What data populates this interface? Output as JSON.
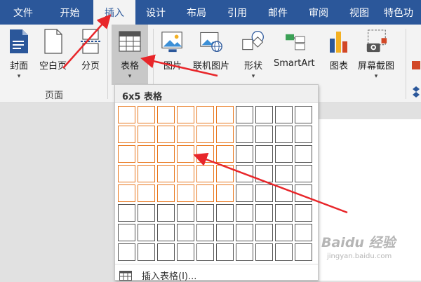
{
  "tabs": [
    {
      "label": "文件",
      "active": false
    },
    {
      "label": "开始",
      "active": false
    },
    {
      "label": "插入",
      "active": true
    },
    {
      "label": "设计",
      "active": false
    },
    {
      "label": "布局",
      "active": false
    },
    {
      "label": "引用",
      "active": false
    },
    {
      "label": "邮件",
      "active": false
    },
    {
      "label": "审阅",
      "active": false
    },
    {
      "label": "视图",
      "active": false
    },
    {
      "label": "特色功",
      "active": false
    }
  ],
  "ribbon": {
    "cover": "封面",
    "blank_page": "空白页",
    "page_break": "分页",
    "pages_group": "页面",
    "table": "表格",
    "picture": "图片",
    "online_picture": "联机图片",
    "shapes": "形状",
    "smartart": "SmartArt",
    "chart": "图表",
    "screenshot": "屏幕截图"
  },
  "table_dropdown": {
    "title": "6x5 表格",
    "rows": 8,
    "cols": 10,
    "selected_cols": 6,
    "selected_rows": 5,
    "insert_table": "插入表格(I)..."
  },
  "watermark": {
    "brand": "Baidu 经验",
    "url": "jingyan.baidu.com"
  },
  "colors": {
    "accent": "#2b579a",
    "selection": "#e8761c",
    "annotation": "#e8262a"
  }
}
